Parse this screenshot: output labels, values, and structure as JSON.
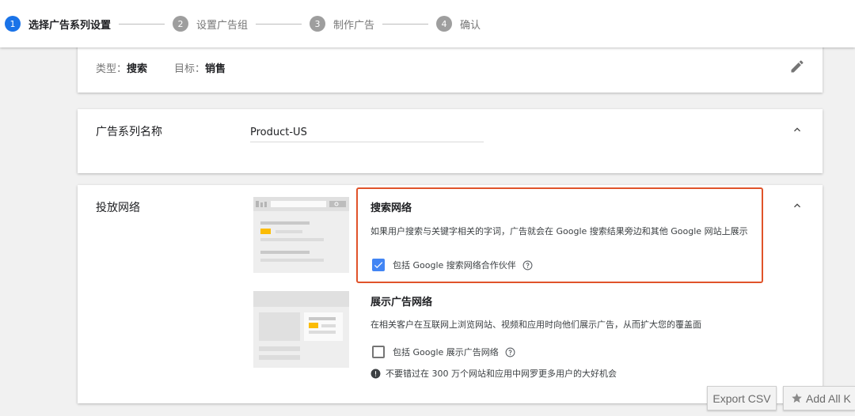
{
  "stepper": {
    "steps": [
      {
        "num": "1",
        "label": "选择广告系列设置"
      },
      {
        "num": "2",
        "label": "设置广告组"
      },
      {
        "num": "3",
        "label": "制作广告"
      },
      {
        "num": "4",
        "label": "确认"
      }
    ]
  },
  "summary": {
    "type_label": "类型：",
    "type_value": "搜索",
    "goal_label": "目标：",
    "goal_value": "销售",
    "edit_icon": "pencil-icon"
  },
  "campaign_name": {
    "label": "广告系列名称",
    "value": "Product-US"
  },
  "network": {
    "label": "投放网络",
    "search": {
      "title": "搜索网络",
      "desc": "如果用户搜索与关键字相关的字词，广告就会在 Google 搜索结果旁边和其他 Google 网站上展示",
      "checkbox_label": "包括 Google 搜索网络合作伙伴",
      "checked": true
    },
    "display": {
      "title": "展示广告网络",
      "desc": "在相关客户在互联网上浏览网站、视频和应用时向他们展示广告，从而扩大您的覆盖面",
      "checkbox_label": "包括 Google 展示广告网络",
      "checked": false
    },
    "notice": "不要错过在 300 万个网站和应用中网罗更多用户的大好机会"
  },
  "buttons": {
    "export_csv": "Export CSV",
    "add_all": "Add All K"
  },
  "colors": {
    "accent": "#1a73e8",
    "checkbox": "#4285f4",
    "highlight": "#e0532a"
  }
}
